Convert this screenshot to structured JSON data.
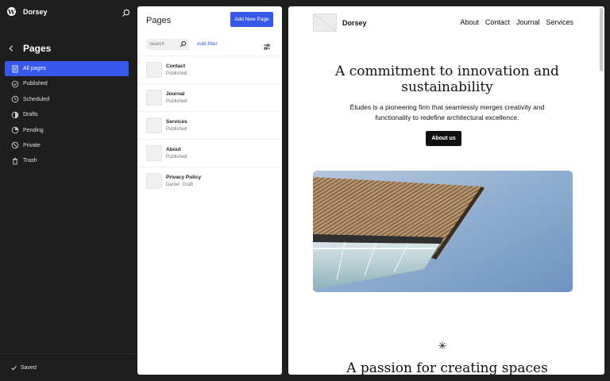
{
  "site": {
    "name": "Dorsey"
  },
  "sidebar": {
    "title": "Pages",
    "items": [
      {
        "label": "All pages",
        "icon": "pages-icon",
        "active": true
      },
      {
        "label": "Published",
        "icon": "published-icon"
      },
      {
        "label": "Scheduled",
        "icon": "scheduled-icon"
      },
      {
        "label": "Drafts",
        "icon": "drafts-icon"
      },
      {
        "label": "Pending",
        "icon": "pending-icon"
      },
      {
        "label": "Private",
        "icon": "private-icon"
      },
      {
        "label": "Trash",
        "icon": "trash-icon"
      }
    ],
    "footer_status": "Saved"
  },
  "list": {
    "title": "Pages",
    "add_button": "Add New Page",
    "search_placeholder": "Search",
    "add_filter": "Add filter",
    "rows": [
      {
        "title": "Contact",
        "status": "Published"
      },
      {
        "title": "Journal",
        "status": "Published"
      },
      {
        "title": "Services",
        "status": "Published"
      },
      {
        "title": "About",
        "status": "Published"
      },
      {
        "title": "Privacy Policy",
        "author": "Daniel",
        "status": "Draft"
      }
    ]
  },
  "preview": {
    "site_name": "Dorsey",
    "nav": [
      "About",
      "Contact",
      "Journal",
      "Services"
    ],
    "heading": "A commitment to innovation and sustainability",
    "text": "Études is a pioneering firm that seamlessly merges creativity and functionality to redefine architectural excellence.",
    "cta": "About us",
    "asterisk": "✳",
    "heading2": "A passion for creating spaces"
  },
  "colors": {
    "accent": "#3858e9",
    "sidebar_bg": "#1e1e1e",
    "panel_bg": "#ffffff"
  }
}
